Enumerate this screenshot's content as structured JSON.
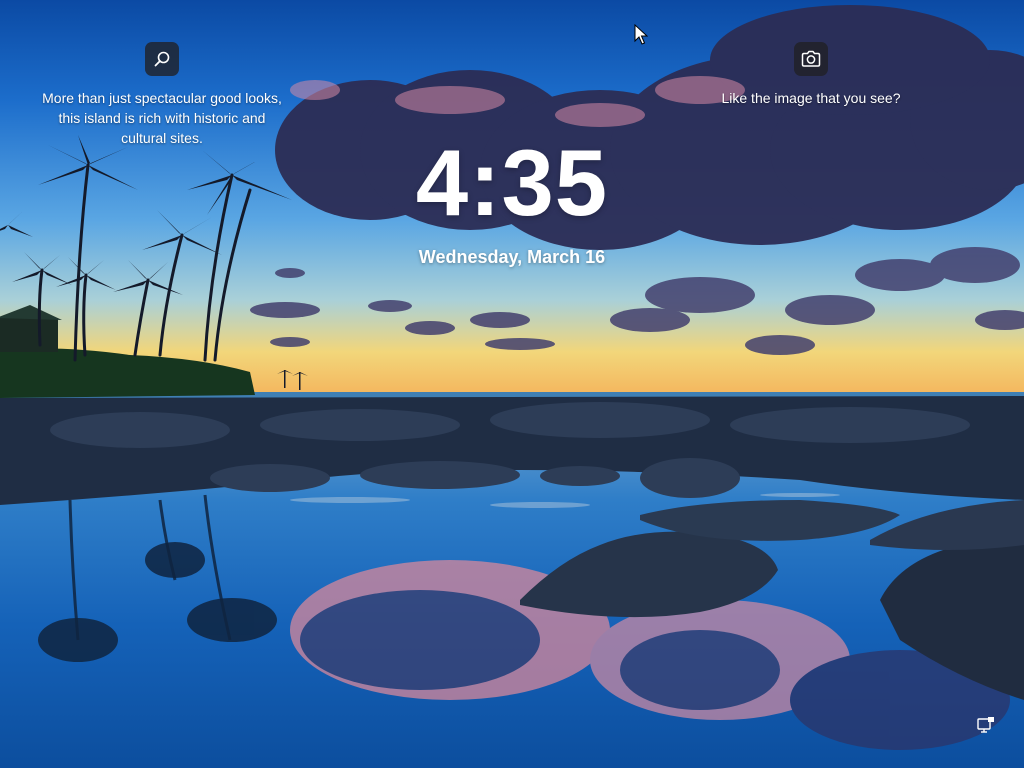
{
  "lock_screen": {
    "time": "4:35",
    "date": "Wednesday, March 16"
  },
  "spotlight": {
    "info_caption": "More than just spectacular good looks, this island is rich with historic and cultural sites.",
    "camera_caption": "Like the image that you see?"
  },
  "icons": {
    "info": "search-icon",
    "camera": "camera-icon",
    "network": "network-icon",
    "cursor": "mouse-pointer-icon"
  },
  "colors": {
    "sky_top": "#0d4ea6",
    "sky_mid": "#4f9ae0",
    "horizon": "#f0c45a",
    "water": "#1a63b8",
    "button_bg": "#202024",
    "text": "#ffffff"
  }
}
